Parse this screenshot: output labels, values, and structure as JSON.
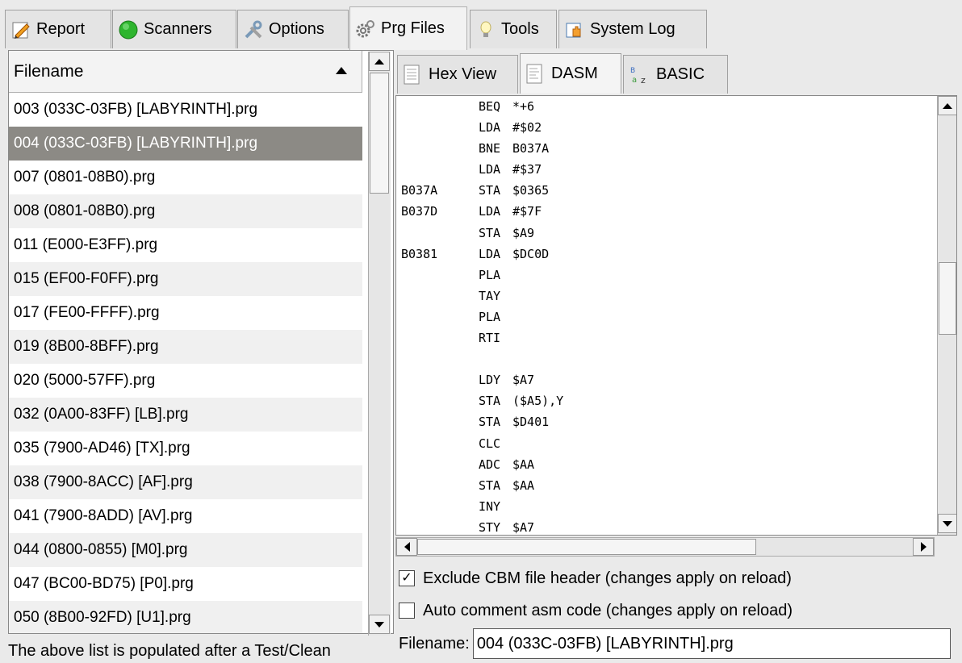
{
  "tabs": [
    {
      "label": "Report",
      "icon": "pencil-note-icon"
    },
    {
      "label": "Scanners",
      "icon": "green-circle-icon"
    },
    {
      "label": "Options",
      "icon": "tools-icon"
    },
    {
      "label": "Prg Files",
      "icon": "gears-icon",
      "active": true
    },
    {
      "label": "Tools",
      "icon": "lightbulb-icon"
    },
    {
      "label": "System Log",
      "icon": "hand-log-icon"
    }
  ],
  "file_list": {
    "header": "Filename",
    "rows": [
      "003 (033C-03FB) [LABYRINTH].prg",
      "004 (033C-03FB) [LABYRINTH].prg",
      "007 (0801-08B0).prg",
      "008 (0801-08B0).prg",
      "011 (E000-E3FF).prg",
      "015 (EF00-F0FF).prg",
      "017 (FE00-FFFF).prg",
      "019 (8B00-8BFF).prg",
      "020 (5000-57FF).prg",
      "032 (0A00-83FF) [LB].prg",
      "035 (7900-AD46) [TX].prg",
      "038 (7900-8ACC) [AF].prg",
      "041 (7900-8ADD) [AV].prg",
      "044 (0800-0855) [M0].prg",
      "047 (BC00-BD75) [P0].prg",
      "050 (8B00-92FD) [U1].prg"
    ],
    "selected_index": 1,
    "status": "The above list is populated after a Test/Clean"
  },
  "subtabs": [
    {
      "label": "Hex View",
      "icon": "document-icon"
    },
    {
      "label": "DASM",
      "icon": "document-lines-icon",
      "active": true
    },
    {
      "label": "BASIC",
      "icon": "basic-abc-icon"
    }
  ],
  "code": [
    {
      "label": "",
      "op": "BEQ",
      "arg": "*+6"
    },
    {
      "label": "",
      "op": "LDA",
      "arg": "#$02"
    },
    {
      "label": "",
      "op": "BNE",
      "arg": "B037A"
    },
    {
      "label": "",
      "op": "LDA",
      "arg": "#$37"
    },
    {
      "label": "B037A",
      "op": "STA",
      "arg": "$0365"
    },
    {
      "label": "B037D",
      "op": "LDA",
      "arg": "#$7F"
    },
    {
      "label": "",
      "op": "STA",
      "arg": "$A9"
    },
    {
      "label": "B0381",
      "op": "LDA",
      "arg": "$DC0D"
    },
    {
      "label": "",
      "op": "PLA",
      "arg": ""
    },
    {
      "label": "",
      "op": "TAY",
      "arg": ""
    },
    {
      "label": "",
      "op": "PLA",
      "arg": ""
    },
    {
      "label": "",
      "op": "RTI",
      "arg": ""
    },
    {
      "label": "",
      "op": "",
      "arg": ""
    },
    {
      "label": "",
      "op": "LDY",
      "arg": "$A7"
    },
    {
      "label": "",
      "op": "STA",
      "arg": "($A5),Y"
    },
    {
      "label": "",
      "op": "STA",
      "arg": "$D401"
    },
    {
      "label": "",
      "op": "CLC",
      "arg": ""
    },
    {
      "label": "",
      "op": "ADC",
      "arg": "$AA"
    },
    {
      "label": "",
      "op": "STA",
      "arg": "$AA"
    },
    {
      "label": "",
      "op": "INY",
      "arg": ""
    },
    {
      "label": "",
      "op": "STY",
      "arg": "$A7"
    }
  ],
  "options": {
    "exclude_header": {
      "label": "Exclude CBM file header (changes apply on reload)",
      "checked": true
    },
    "auto_comment": {
      "label": "Auto comment asm code (changes apply on reload)",
      "checked": false
    }
  },
  "filename": {
    "label": "Filename:",
    "value": "004 (033C-03FB) [LABYRINTH].prg"
  }
}
